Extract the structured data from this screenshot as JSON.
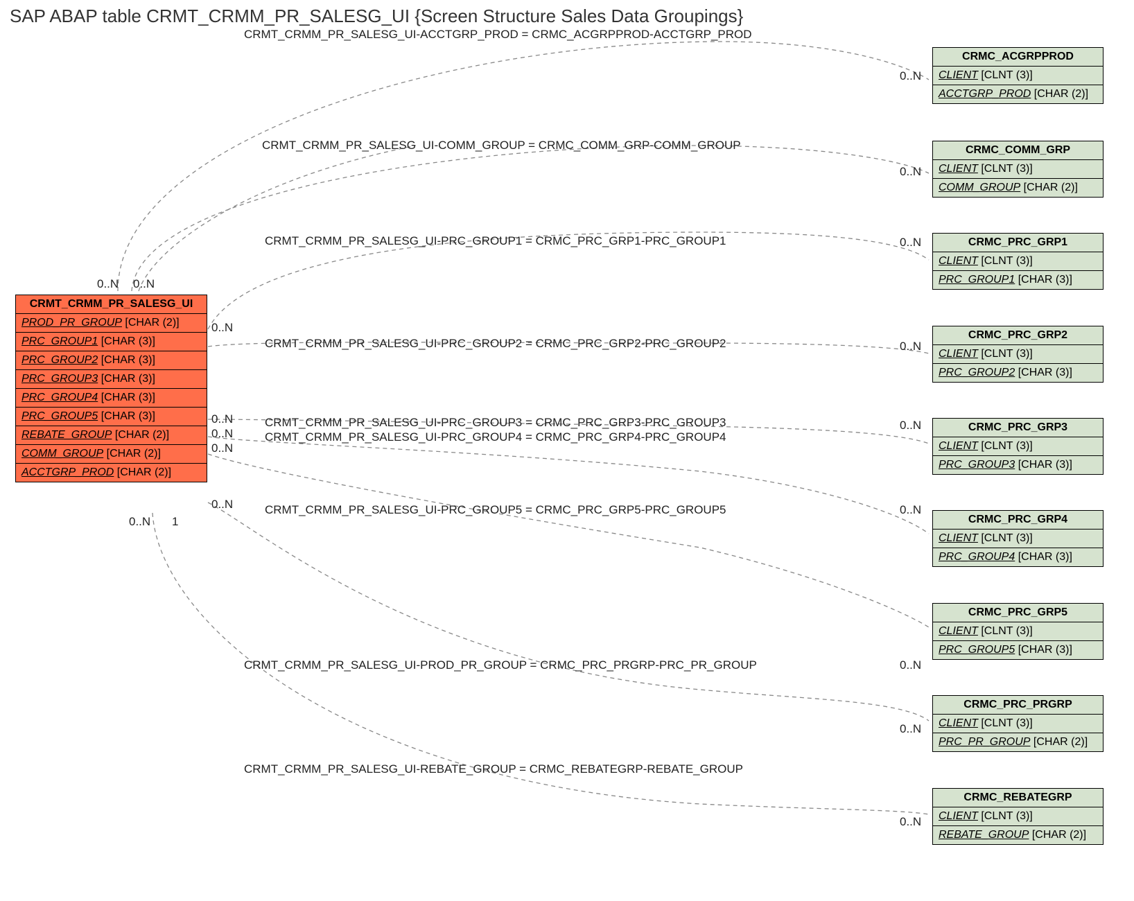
{
  "title": "SAP ABAP table CRMT_CRMM_PR_SALESG_UI {Screen Structure Sales Data Groupings}",
  "main": {
    "name": "CRMT_CRMM_PR_SALESG_UI",
    "fields": [
      {
        "n": "PROD_PR_GROUP",
        "t": " [CHAR (2)]"
      },
      {
        "n": "PRC_GROUP1",
        "t": " [CHAR (3)]"
      },
      {
        "n": "PRC_GROUP2",
        "t": " [CHAR (3)]"
      },
      {
        "n": "PRC_GROUP3",
        "t": " [CHAR (3)]"
      },
      {
        "n": "PRC_GROUP4",
        "t": " [CHAR (3)]"
      },
      {
        "n": "PRC_GROUP5",
        "t": " [CHAR (3)]"
      },
      {
        "n": "REBATE_GROUP",
        "t": " [CHAR (2)]"
      },
      {
        "n": "COMM_GROUP",
        "t": " [CHAR (2)]"
      },
      {
        "n": "ACCTGRP_PROD",
        "t": " [CHAR (2)]"
      }
    ]
  },
  "refs": [
    {
      "name": "CRMC_ACGRPPROD",
      "f1n": "CLIENT",
      "f1t": " [CLNT (3)]",
      "f2n": "ACCTGRP_PROD",
      "f2t": " [CHAR (2)]"
    },
    {
      "name": "CRMC_COMM_GRP",
      "f1n": "CLIENT",
      "f1t": " [CLNT (3)]",
      "f2n": "COMM_GROUP",
      "f2t": " [CHAR (2)]"
    },
    {
      "name": "CRMC_PRC_GRP1",
      "f1n": "CLIENT",
      "f1t": " [CLNT (3)]",
      "f2n": "PRC_GROUP1",
      "f2t": " [CHAR (3)]"
    },
    {
      "name": "CRMC_PRC_GRP2",
      "f1n": "CLIENT",
      "f1t": " [CLNT (3)]",
      "f2n": "PRC_GROUP2",
      "f2t": " [CHAR (3)]"
    },
    {
      "name": "CRMC_PRC_GRP3",
      "f1n": "CLIENT",
      "f1t": " [CLNT (3)]",
      "f2n": "PRC_GROUP3",
      "f2t": " [CHAR (3)]"
    },
    {
      "name": "CRMC_PRC_GRP4",
      "f1n": "CLIENT",
      "f1t": " [CLNT (3)]",
      "f2n": "PRC_GROUP4",
      "f2t": " [CHAR (3)]"
    },
    {
      "name": "CRMC_PRC_GRP5",
      "f1n": "CLIENT",
      "f1t": " [CLNT (3)]",
      "f2n": "PRC_GROUP5",
      "f2t": " [CHAR (3)]"
    },
    {
      "name": "CRMC_PRC_PRGRP",
      "f1n": "CLIENT",
      "f1t": " [CLNT (3)]",
      "f2n": "PRC_PR_GROUP",
      "f2t": " [CHAR (2)]"
    },
    {
      "name": "CRMC_REBATEGRP",
      "f1n": "CLIENT",
      "f1t": " [CLNT (3)]",
      "f2n": "REBATE_GROUP",
      "f2t": " [CHAR (2)]"
    }
  ],
  "rels": [
    "CRMT_CRMM_PR_SALESG_UI-ACCTGRP_PROD = CRMC_ACGRPPROD-ACCTGRP_PROD",
    "CRMT_CRMM_PR_SALESG_UI-COMM_GROUP = CRMC_COMM_GRP-COMM_GROUP",
    "CRMT_CRMM_PR_SALESG_UI-PRC_GROUP1 = CRMC_PRC_GRP1-PRC_GROUP1",
    "CRMT_CRMM_PR_SALESG_UI-PRC_GROUP2 = CRMC_PRC_GRP2-PRC_GROUP2",
    "CRMT_CRMM_PR_SALESG_UI-PRC_GROUP3 = CRMC_PRC_GRP3-PRC_GROUP3",
    "CRMT_CRMM_PR_SALESG_UI-PRC_GROUP4 = CRMC_PRC_GRP4-PRC_GROUP4",
    "CRMT_CRMM_PR_SALESG_UI-PRC_GROUP5 = CRMC_PRC_GRP5-PRC_GROUP5",
    "CRMT_CRMM_PR_SALESG_UI-PROD_PR_GROUP = CRMC_PRC_PRGRP-PRC_PR_GROUP",
    "CRMT_CRMM_PR_SALESG_UI-REBATE_GROUP = CRMC_REBATEGRP-REBATE_GROUP"
  ],
  "cards": {
    "zn": "0..N",
    "one": "1"
  }
}
